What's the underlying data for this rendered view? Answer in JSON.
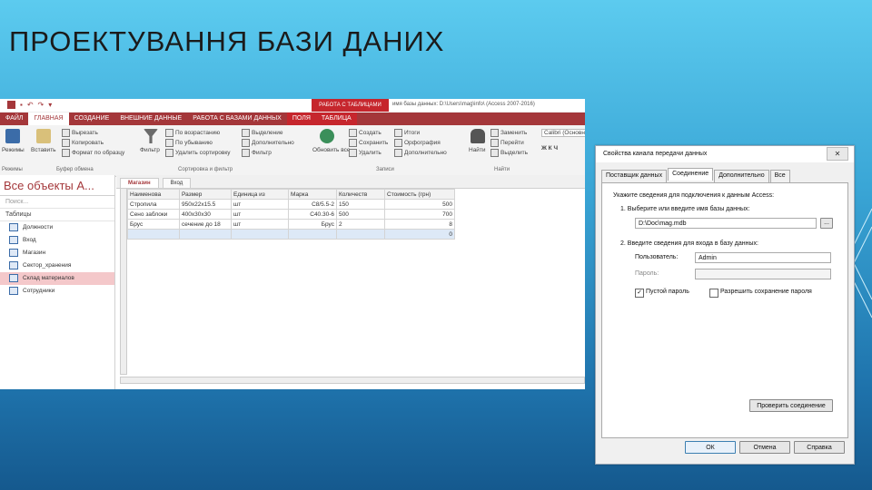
{
  "slide": {
    "title": "ПРОЕКТУВАННЯ БАЗИ ДАНИХ"
  },
  "access": {
    "context_tab": "РАБОТА С ТАБЛИЦАМИ",
    "caption": "имя базы данных: D:\\Users\\mag\\info\\ (Access 2007-2016)",
    "tabs": [
      "ФАЙЛ",
      "ГЛАВНАЯ",
      "СОЗДАНИЕ",
      "ВНЕШНИЕ ДАННЫЕ",
      "РАБОТА С БАЗАМИ ДАННЫХ",
      "ПОЛЯ",
      "ТАБЛИЦА"
    ],
    "ribbon": {
      "views": "Режимы",
      "paste": "Вставить",
      "filter": "Фильтр",
      "refresh": "Обновить все",
      "find": "Найти",
      "cut": "Вырезать",
      "copy": "Копировать",
      "format_painter": "Формат по образцу",
      "asc": "По возрастанию",
      "desc": "По убыванию",
      "remove_sort": "Удалить сортировку",
      "selection": "Выделение",
      "advanced": "Дополнительно",
      "toggle_filter": "Фильтр",
      "new": "Создать",
      "save": "Сохранить",
      "delete": "Удалить",
      "totals": "Итоги",
      "spelling": "Орфография",
      "more": "Дополнительно",
      "replace": "Заменить",
      "goto": "Перейти",
      "select": "Выделить",
      "font": "Calibri (Основной",
      "groups": [
        "Режимы",
        "Буфер обмена",
        "Сортировка и фильтр",
        "Записи",
        "Найти"
      ]
    },
    "nav": {
      "title": "Все объекты A...",
      "search_placeholder": "Поиск...",
      "section": "Таблицы",
      "items": [
        "Должности",
        "Вход",
        "Магазин",
        "Сектор_хранения",
        "Склад материалов",
        "Сотрудники"
      ]
    },
    "doc_tabs": [
      "Магазин",
      "Вход"
    ],
    "table": {
      "headers": [
        "Наименова",
        "Размер",
        "Единица из",
        "Марка",
        "Количеств",
        "Стоимость (грн)"
      ],
      "rows": [
        [
          "Стропила",
          "950x22x15.5",
          "шт",
          "С8/5.5-2",
          "150",
          "500"
        ],
        [
          "Сено заблоки",
          "400x30x30",
          "шт",
          "С40.30-6",
          "500",
          "700"
        ],
        [
          "Брус",
          "сечение до 18",
          "шт",
          "Брус",
          "2",
          "8"
        ]
      ],
      "new_row_value": "0"
    }
  },
  "dialog": {
    "title": "Свойства канала передачи данных",
    "close": "✕",
    "tabs": [
      "Поставщик данных",
      "Соединение",
      "Дополнительно",
      "Все"
    ],
    "intro": "Укажите сведения для подключения к данным Access:",
    "step1": "1. Выберите или введите имя базы данных:",
    "db_path": "D:\\Doc\\mag.mdb",
    "browse": "...",
    "step2": "2. Введите сведения для входа в базу данных:",
    "user_label": "Пользователь:",
    "user_value": "Admin",
    "password_label": "Пароль:",
    "password_value": "",
    "blank_password": "Пустой пароль",
    "blank_password_checked": "✓",
    "allow_save": "Разрешить сохранение пароля",
    "test_button": "Проверить соединение",
    "ok": "ОК",
    "cancel": "Отмена",
    "help": "Справка"
  },
  "colors": {
    "accent": "#a4373a",
    "context": "#c6262d",
    "bg_top": "#5ccbef",
    "bg_bottom": "#15598e"
  }
}
